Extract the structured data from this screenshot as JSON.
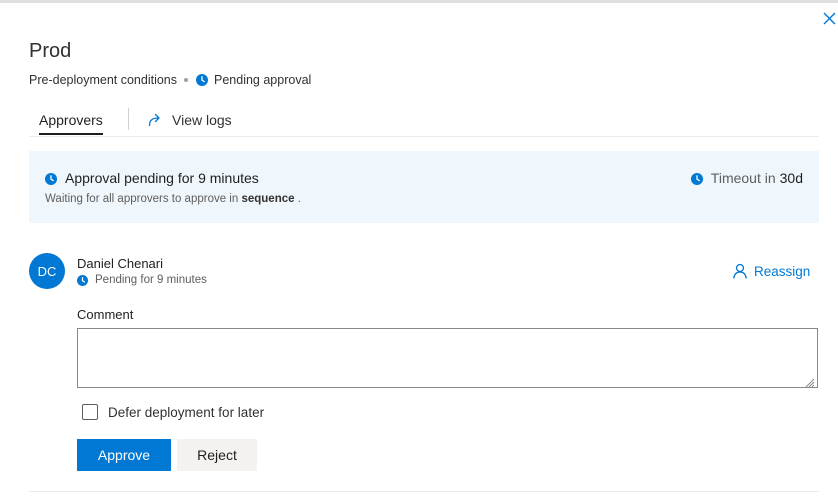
{
  "panel": {
    "title": "Prod",
    "stage": "Pre-deployment conditions",
    "stage_status": "Pending approval"
  },
  "tabs": {
    "approvers_label": "Approvers",
    "view_logs_label": "View logs"
  },
  "banner": {
    "headline": "Approval pending for 9 minutes",
    "detail_prefix": "Waiting for all approvers to approve in",
    "detail_mode": "sequence",
    "detail_suffix": ".",
    "timeout_label": "Timeout in",
    "timeout_value": "30d"
  },
  "approver": {
    "initials": "DC",
    "name": "Daniel Chenari",
    "status": "Pending for 9 minutes",
    "reassign_label": "Reassign"
  },
  "form": {
    "comment_label": "Comment",
    "comment_value": "",
    "defer_label": "Defer deployment for later",
    "defer_checked": false,
    "approve_label": "Approve",
    "reject_label": "Reject"
  },
  "colors": {
    "accent": "#0078d4",
    "banner_bg": "#eff6fc",
    "secondary_button_bg": "#f3f2f1"
  },
  "icons": {
    "close": "close-icon",
    "clock": "clock-icon",
    "view_logs": "share-arrow-icon",
    "reassign": "person-icon"
  }
}
